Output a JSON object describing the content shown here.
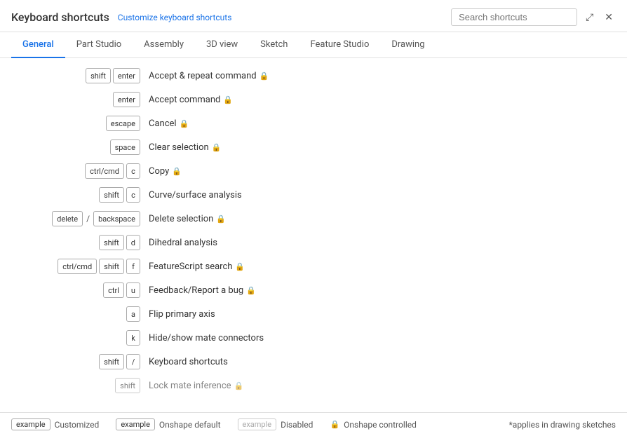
{
  "header": {
    "title": "Keyboard shortcuts",
    "customize_link": "Customize keyboard shortcuts",
    "search_placeholder": "Search shortcuts",
    "expand_icon": "⤢",
    "close_icon": "✕"
  },
  "tabs": [
    {
      "label": "General",
      "active": true
    },
    {
      "label": "Part Studio",
      "active": false
    },
    {
      "label": "Assembly",
      "active": false
    },
    {
      "label": "3D view",
      "active": false
    },
    {
      "label": "Sketch",
      "active": false
    },
    {
      "label": "Feature Studio",
      "active": false
    },
    {
      "label": "Drawing",
      "active": false
    }
  ],
  "shortcuts": [
    {
      "keys": [
        {
          "text": "shift"
        },
        {
          "sep": "+"
        },
        {
          "text": "enter"
        }
      ],
      "label": "Accept & repeat command",
      "locked": true
    },
    {
      "keys": [
        {
          "text": "enter"
        }
      ],
      "label": "Accept command",
      "locked": true
    },
    {
      "keys": [
        {
          "text": "escape"
        }
      ],
      "label": "Cancel",
      "locked": true
    },
    {
      "keys": [
        {
          "text": "space"
        }
      ],
      "label": "Clear selection",
      "locked": true
    },
    {
      "keys": [
        {
          "text": "ctrl/cmd"
        },
        {
          "sep": "+"
        },
        {
          "text": "c"
        }
      ],
      "label": "Copy",
      "locked": true
    },
    {
      "keys": [
        {
          "text": "shift"
        },
        {
          "sep": "+"
        },
        {
          "text": "c"
        }
      ],
      "label": "Curve/surface analysis",
      "locked": false
    },
    {
      "keys": [
        {
          "text": "delete"
        },
        {
          "sep": "/"
        },
        {
          "text": "backspace"
        }
      ],
      "label": "Delete selection",
      "locked": true
    },
    {
      "keys": [
        {
          "text": "shift"
        },
        {
          "sep": "+"
        },
        {
          "text": "d"
        }
      ],
      "label": "Dihedral analysis",
      "locked": false
    },
    {
      "keys": [
        {
          "text": "ctrl/cmd"
        },
        {
          "sep": "+"
        },
        {
          "text": "shift"
        },
        {
          "sep": "+"
        },
        {
          "text": "f"
        }
      ],
      "label": "FeatureScript search",
      "locked": true
    },
    {
      "keys": [
        {
          "text": "ctrl"
        },
        {
          "sep": "+"
        },
        {
          "text": "u"
        }
      ],
      "label": "Feedback/Report a bug",
      "locked": true
    },
    {
      "keys": [
        {
          "text": "a"
        }
      ],
      "label": "Flip primary axis",
      "locked": false
    },
    {
      "keys": [
        {
          "text": "k"
        }
      ],
      "label": "Hide/show mate connectors",
      "locked": false
    },
    {
      "keys": [
        {
          "text": "shift"
        },
        {
          "sep": "+"
        },
        {
          "text": "/"
        }
      ],
      "label": "Keyboard shortcuts",
      "locked": false
    },
    {
      "keys": [
        {
          "text": "shift"
        }
      ],
      "label": "Lock mate inference",
      "locked": true,
      "partial": true
    }
  ],
  "footer": {
    "customized_label": "example",
    "customized_text": "Customized",
    "default_label": "example",
    "default_text": "Onshape default",
    "disabled_label": "example",
    "disabled_text": "Disabled",
    "controlled_text": "Onshape controlled",
    "note": "*applies in drawing sketches"
  }
}
